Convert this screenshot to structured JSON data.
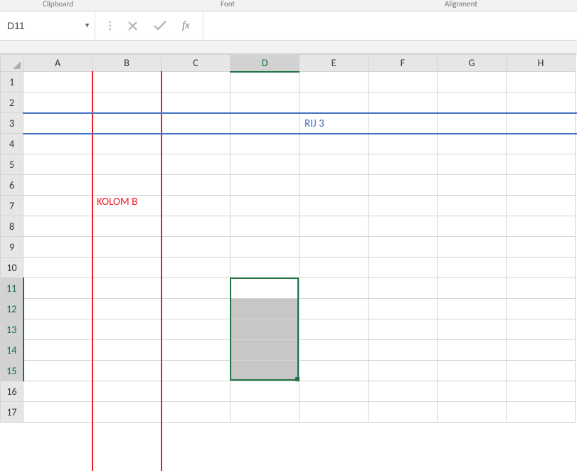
{
  "ribbon": {
    "group1": "Clipboard",
    "group2": "Font",
    "group3": "Alignment"
  },
  "namebox": {
    "value": "D11"
  },
  "fx": {
    "label": "fx"
  },
  "formula": {
    "value": ""
  },
  "columns": [
    "A",
    "B",
    "C",
    "D",
    "E",
    "F",
    "G",
    "H"
  ],
  "rows": [
    "1",
    "2",
    "3",
    "4",
    "5",
    "6",
    "7",
    "8",
    "9",
    "10",
    "11",
    "12",
    "13",
    "14",
    "15",
    "16",
    "17"
  ],
  "active_col_index": 3,
  "active_rows": [
    10,
    11,
    12,
    13,
    14
  ],
  "selection": {
    "top_row": 10,
    "bottom_row": 14,
    "col": 3
  },
  "annotations": {
    "row3_label": "RIJ 3",
    "colB_label": "KOLOM B"
  },
  "chart_data": {
    "type": "table",
    "cells": [
      {
        "address": "B7",
        "value": "KOLOM B",
        "note": "red overlay label, not cell content"
      },
      {
        "address": "E3",
        "value": "RIJ 3",
        "note": "blue overlay label, not cell content"
      }
    ],
    "selection": "D11:D15",
    "highlights": {
      "column_B": "red vertical lines bracketing column B",
      "row_3": "blue horizontal lines bracketing row 3"
    }
  }
}
